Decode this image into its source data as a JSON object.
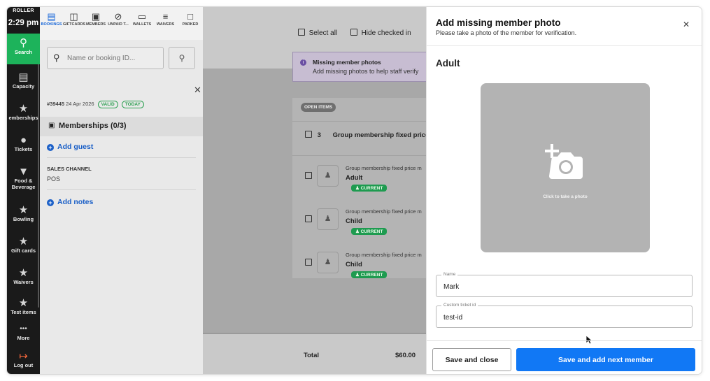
{
  "nav": {
    "brand": "ROLLER",
    "time": "2:29 pm",
    "items": [
      {
        "label": "Search",
        "icon": "search-icon"
      },
      {
        "label": "Capacity",
        "icon": "calendar-icon"
      },
      {
        "label": "emberships",
        "icon": "star-icon"
      },
      {
        "label": "Tickets",
        "icon": "dollar-icon"
      },
      {
        "label": "Food &",
        "label2": "Beverage",
        "icon": "cocktail-icon"
      },
      {
        "label": "Bowling",
        "icon": "star-icon"
      },
      {
        "label": "Gift cards",
        "icon": "star-icon"
      },
      {
        "label": "Waivers",
        "icon": "star-icon"
      },
      {
        "label": "Test items",
        "icon": "star-icon"
      },
      {
        "label": "More",
        "icon": "more-icon"
      },
      {
        "label": "Log out",
        "icon": "logout-icon"
      }
    ]
  },
  "tabs": [
    {
      "label": "BOOKINGS",
      "icon": "calendar-icon"
    },
    {
      "label": "GIFTCARDS",
      "icon": "gift-card-icon"
    },
    {
      "label": "MEMBERS",
      "icon": "member-card-icon"
    },
    {
      "label": "UNPAID T...",
      "icon": "unpaid-icon"
    },
    {
      "label": "WALLETS",
      "icon": "wallet-icon"
    },
    {
      "label": "WAIVERS",
      "icon": "waiver-icon"
    },
    {
      "label": "PARKED",
      "icon": "bookmark-icon"
    }
  ],
  "booking": {
    "search_placeholder": "Name or booking ID...",
    "booking_id": "#39445",
    "booking_date": "24 Apr 2026",
    "pill_valid": "VALID",
    "pill_today": "TODAY",
    "memberships_label": "Memberships (0/3)",
    "add_guest": "Add guest",
    "sales_channel_label": "SALES CHANNEL",
    "sales_channel_value": "POS",
    "add_notes": "Add notes"
  },
  "middle": {
    "select_all": "Select all",
    "hide_checked": "Hide checked in",
    "alert_title": "Missing member photos",
    "alert_body": "Add missing photos to help staff verify",
    "open_items": "OPEN ITEMS",
    "group_count": "3",
    "group_name": "Group membership fixed price",
    "members": [
      {
        "title": "Group membership fixed price m",
        "type": "Adult",
        "status": "CURRENT"
      },
      {
        "title": "Group membership fixed price m",
        "type": "Child",
        "status": "CURRENT"
      },
      {
        "title": "Group membership fixed price m",
        "type": "Child",
        "status": "CURRENT"
      }
    ],
    "total_label": "Total",
    "total_value": "$60.00"
  },
  "drawer": {
    "title": "Add missing member photo",
    "subtitle": "Please take a photo of the member for verification.",
    "section": "Adult",
    "photo_hint": "Click to take a photo",
    "name_label": "Name",
    "name_value": "Mark",
    "ticket_label": "Custom ticket id",
    "ticket_value": "test-id",
    "save_close": "Save and close",
    "save_next": "Save and add next member"
  },
  "colors": {
    "accent_green": "#1db35b",
    "primary_blue": "#1178f5",
    "link_blue": "#1a5fc7",
    "alert_purple": "#6a4fa3"
  }
}
